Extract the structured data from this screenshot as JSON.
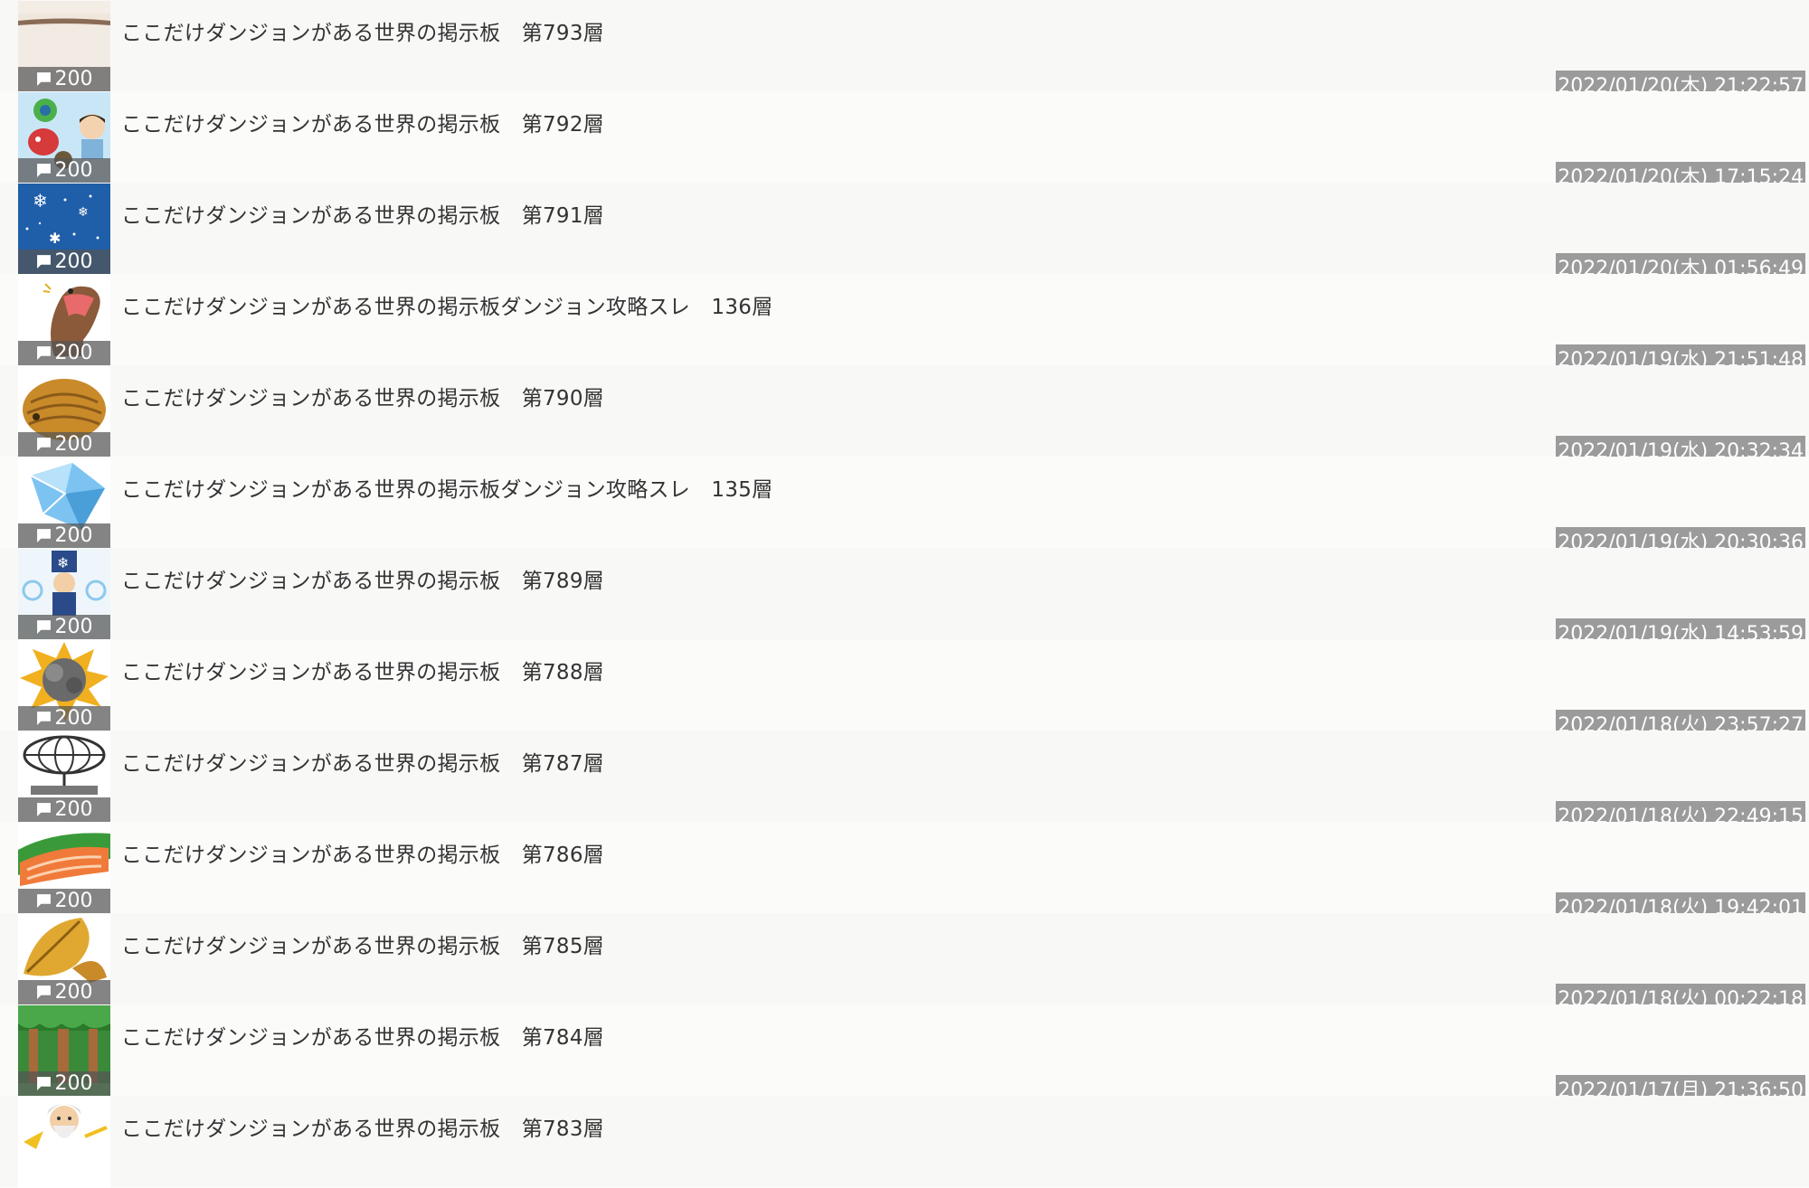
{
  "threads": [
    {
      "title": "ここだけダンジョンがある世界の掲示板　第793層",
      "count": "200",
      "date": "2022/01/20(木) 21:22:57",
      "icon": "blank-bg-thumbnail"
    },
    {
      "title": "ここだけダンジョンがある世界の掲示板　第792層",
      "count": "200",
      "date": "2022/01/20(木) 17:15:24",
      "icon": "monster-boy-thumbnail"
    },
    {
      "title": "ここだけダンジョンがある世界の掲示板　第791層",
      "count": "200",
      "date": "2022/01/20(木) 01:56:49",
      "icon": "snow-night-thumbnail"
    },
    {
      "title": "ここだけダンジョンがある世界の掲示板ダンジョン攻略スレ　136層",
      "count": "200",
      "date": "2022/01/19(水) 21:51:48",
      "icon": "snake-thumbnail"
    },
    {
      "title": "ここだけダンジョンがある世界の掲示板　第790層",
      "count": "200",
      "date": "2022/01/19(水) 20:32:34",
      "icon": "isopod-thumbnail"
    },
    {
      "title": "ここだけダンジョンがある世界の掲示板ダンジョン攻略スレ　135層",
      "count": "200",
      "date": "2022/01/19(水) 20:30:36",
      "icon": "crystal-thumbnail"
    },
    {
      "title": "ここだけダンジョンがある世界の掲示板　第789層",
      "count": "200",
      "date": "2022/01/19(水) 14:53:59",
      "icon": "ice-wizard-thumbnail"
    },
    {
      "title": "ここだけダンジョンがある世界の掲示板　第788層",
      "count": "200",
      "date": "2022/01/18(火) 23:57:27",
      "icon": "explosion-thumbnail"
    },
    {
      "title": "ここだけダンジョンがある世界の掲示板　第787層",
      "count": "200",
      "date": "2022/01/18(火) 22:49:15",
      "icon": "sphere-frame-thumbnail"
    },
    {
      "title": "ここだけダンジョンがある世界の掲示板　第786層",
      "count": "200",
      "date": "2022/01/18(火) 19:42:01",
      "icon": "salmon-thumbnail"
    },
    {
      "title": "ここだけダンジョンがある世界の掲示板　第785層",
      "count": "200",
      "date": "2022/01/18(火) 00:22:18",
      "icon": "feather-thumbnail"
    },
    {
      "title": "ここだけダンジョンがある世界の掲示板　第784層",
      "count": "200",
      "date": "2022/01/17(月) 21:36:50",
      "icon": "forest-thumbnail"
    },
    {
      "title": "ここだけダンジョンがある世界の掲示板　第783層",
      "count": "",
      "date": "",
      "icon": "old-man-thumbnail"
    }
  ],
  "colors": {
    "date_badge": "#9b9b9b",
    "count_overlay": "#545454",
    "title_text": "#333333"
  }
}
